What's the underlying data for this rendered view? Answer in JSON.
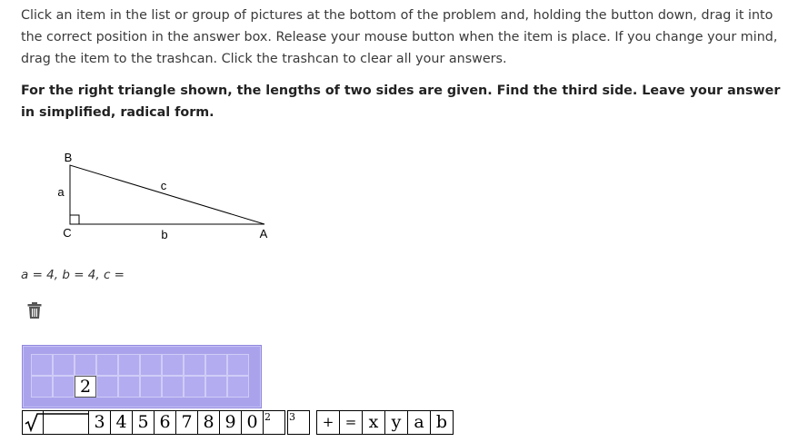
{
  "instructions": "Click an item in the list or group of pictures at the bottom of the problem and, holding the button down, drag it into the correct position in the answer box. Release your mouse button when the item is place. If you change your mind, drag the item to the trashcan. Click the trashcan to clear all your answers.",
  "question": "For the right triangle shown, the lengths of two sides are given. Find the third side. Leave your answer in simplified, radical form.",
  "figure": {
    "vertex_b": "B",
    "vertex_c": "C",
    "vertex_a": "A",
    "side_a": "a",
    "side_b": "b",
    "side_c": "c"
  },
  "equation": "a = 4, b = 4, c =",
  "answer_box": {
    "placed_value": "2"
  },
  "icons": {
    "trash": "trash-icon",
    "sqrt": "square-root-tile"
  },
  "tiles": {
    "n3": "3",
    "n4": "4",
    "n5": "5",
    "n6": "6",
    "n7": "7",
    "n8": "8",
    "n9": "9",
    "n0": "0",
    "sup2": "2",
    "sup3": "3",
    "plus": "+",
    "equals": "=",
    "x": "x",
    "y": "y",
    "a": "a",
    "b": "b"
  },
  "colors": {
    "answer_box_bg": "#aaa3ec",
    "answer_cell": "#b3acf0"
  }
}
